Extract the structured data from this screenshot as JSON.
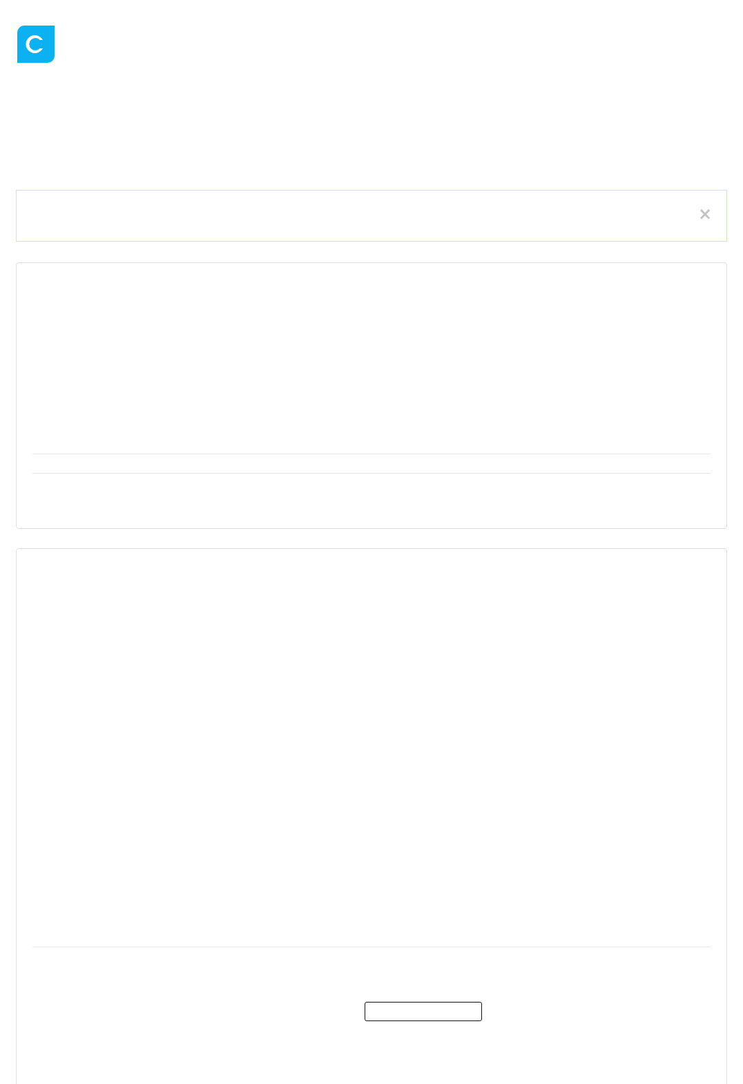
{
  "alert": {
    "close": "×"
  }
}
